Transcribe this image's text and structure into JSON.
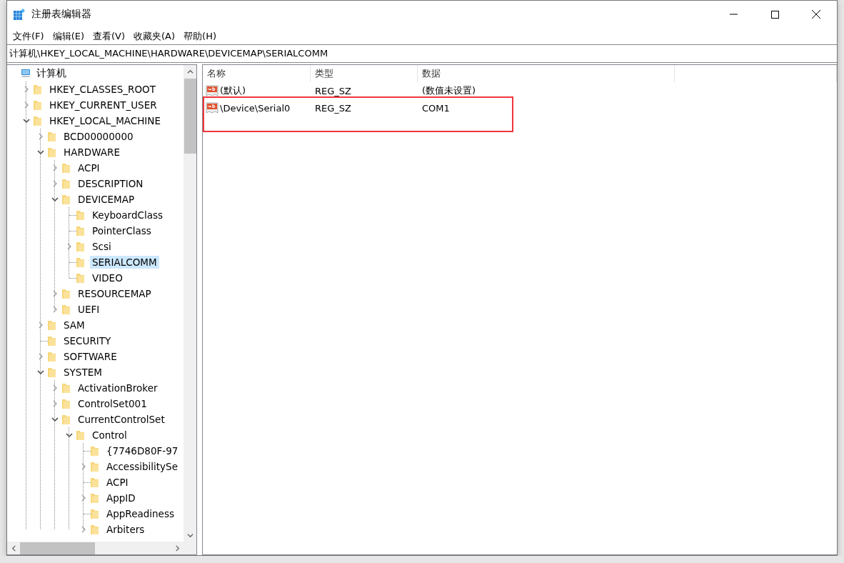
{
  "window": {
    "title": "注册表编辑器"
  },
  "menu": [
    {
      "label": "文件(F)"
    },
    {
      "label": "编辑(E)"
    },
    {
      "label": "查看(V)"
    },
    {
      "label": "收藏夹(A)"
    },
    {
      "label": "帮助(H)"
    }
  ],
  "address": {
    "value": "计算机\\HKEY_LOCAL_MACHINE\\HARDWARE\\DEVICEMAP\\SERIALCOMM"
  },
  "tree": {
    "label": "计算机",
    "kind": "computer",
    "selected": false,
    "children": [
      {
        "label": "HKEY_CLASSES_ROOT",
        "kind": "folder",
        "expandable": true,
        "expanded": false,
        "selected": false
      },
      {
        "label": "HKEY_CURRENT_USER",
        "kind": "folder",
        "expandable": true,
        "expanded": false,
        "selected": false
      },
      {
        "label": "HKEY_LOCAL_MACHINE",
        "kind": "folder",
        "expandable": true,
        "expanded": true,
        "selected": false,
        "children": [
          {
            "label": "BCD00000000",
            "kind": "folder",
            "expandable": true,
            "expanded": false,
            "selected": false
          },
          {
            "label": "HARDWARE",
            "kind": "folder",
            "expandable": true,
            "expanded": true,
            "selected": false,
            "children": [
              {
                "label": "ACPI",
                "kind": "folder",
                "expandable": true,
                "expanded": false,
                "selected": false
              },
              {
                "label": "DESCRIPTION",
                "kind": "folder",
                "expandable": true,
                "expanded": false,
                "selected": false
              },
              {
                "label": "DEVICEMAP",
                "kind": "folder",
                "expandable": true,
                "expanded": true,
                "selected": false,
                "children": [
                  {
                    "label": "KeyboardClass",
                    "kind": "folder",
                    "expandable": false,
                    "selected": false
                  },
                  {
                    "label": "PointerClass",
                    "kind": "folder",
                    "expandable": false,
                    "selected": false
                  },
                  {
                    "label": "Scsi",
                    "kind": "folder",
                    "expandable": true,
                    "expanded": false,
                    "selected": false
                  },
                  {
                    "label": "SERIALCOMM",
                    "kind": "folder",
                    "expandable": false,
                    "selected": true
                  },
                  {
                    "label": "VIDEO",
                    "kind": "folder",
                    "expandable": false,
                    "selected": false
                  }
                ]
              },
              {
                "label": "RESOURCEMAP",
                "kind": "folder",
                "expandable": true,
                "expanded": false,
                "selected": false
              },
              {
                "label": "UEFI",
                "kind": "folder",
                "expandable": true,
                "expanded": false,
                "selected": false
              }
            ]
          },
          {
            "label": "SAM",
            "kind": "folder",
            "expandable": true,
            "expanded": false,
            "selected": false
          },
          {
            "label": "SECURITY",
            "kind": "folder",
            "expandable": false,
            "selected": false
          },
          {
            "label": "SOFTWARE",
            "kind": "folder",
            "expandable": true,
            "expanded": false,
            "selected": false
          },
          {
            "label": "SYSTEM",
            "kind": "folder",
            "expandable": true,
            "expanded": true,
            "selected": false,
            "children": [
              {
                "label": "ActivationBroker",
                "kind": "folder",
                "expandable": true,
                "expanded": false,
                "selected": false
              },
              {
                "label": "ControlSet001",
                "kind": "folder",
                "expandable": true,
                "expanded": false,
                "selected": false
              },
              {
                "label": "CurrentControlSet",
                "kind": "folder",
                "expandable": true,
                "expanded": true,
                "selected": false,
                "children": [
                  {
                    "label": "Control",
                    "kind": "folder",
                    "expandable": true,
                    "expanded": true,
                    "selected": false,
                    "children": [
                      {
                        "label": "{7746D80F-97",
                        "kind": "folder",
                        "expandable": false,
                        "selected": false
                      },
                      {
                        "label": "AccessibilitySe",
                        "kind": "folder",
                        "expandable": true,
                        "expanded": false,
                        "selected": false
                      },
                      {
                        "label": "ACPI",
                        "kind": "folder",
                        "expandable": false,
                        "selected": false
                      },
                      {
                        "label": "AppID",
                        "kind": "folder",
                        "expandable": true,
                        "expanded": false,
                        "selected": false
                      },
                      {
                        "label": "AppReadiness",
                        "kind": "folder",
                        "expandable": false,
                        "selected": false
                      },
                      {
                        "label": "Arbiters",
                        "kind": "folder",
                        "expandable": true,
                        "expanded": false,
                        "selected": false
                      }
                    ]
                  }
                ]
              }
            ]
          }
        ]
      }
    ]
  },
  "values": {
    "columns": [
      "名称",
      "类型",
      "数据"
    ],
    "rows": [
      {
        "name": "(默认)",
        "type": "REG_SZ",
        "data": "(数值未设置)",
        "annotated": false
      },
      {
        "name": "\\Device\\Serial0",
        "type": "REG_SZ",
        "data": "COM1",
        "annotated": true
      }
    ]
  }
}
